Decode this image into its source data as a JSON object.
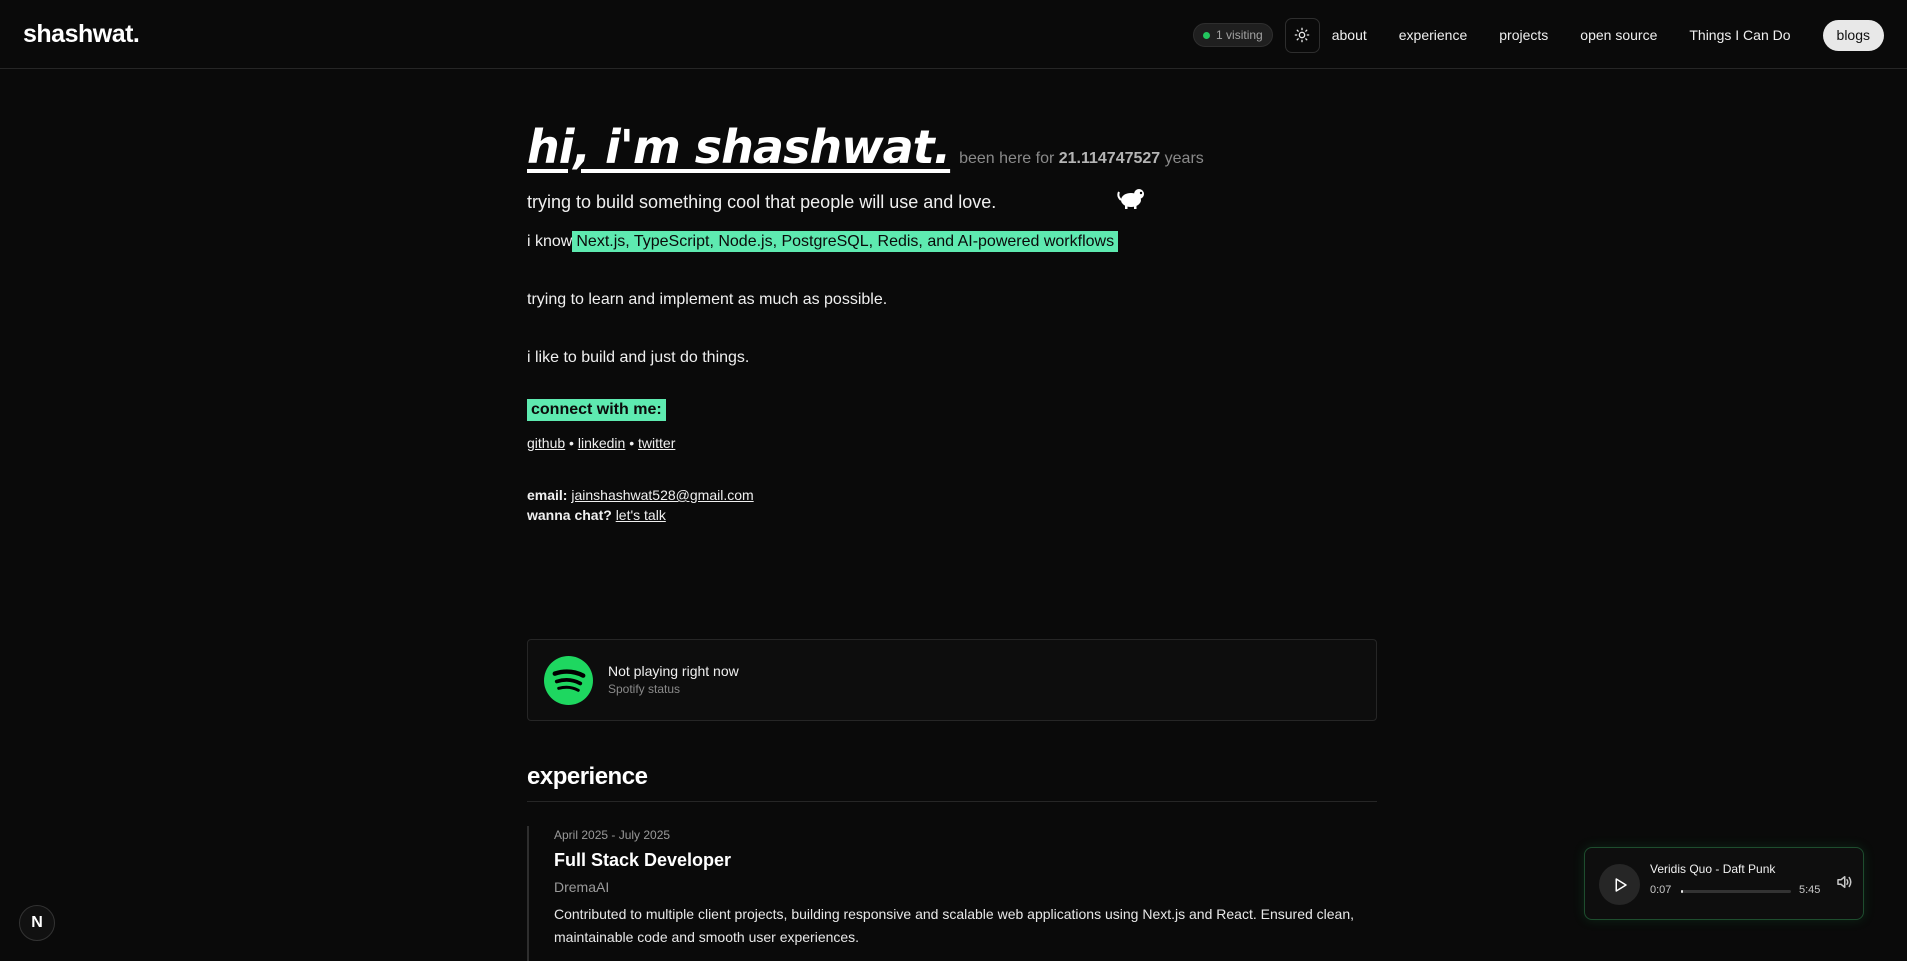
{
  "header": {
    "logo": "shashwat.",
    "visiting": "1 visiting",
    "nav": [
      "about",
      "experience",
      "projects",
      "open source",
      "Things I Can Do"
    ],
    "blogs": "blogs"
  },
  "hero": {
    "title": "hi, i'm shashwat.",
    "been_here_prefix": "been here for",
    "age": "21.114747527",
    "age_unit": "years",
    "tagline": "trying to build something cool that people will use and love.",
    "know_prefix": "i know",
    "skills": "Next.js, TypeScript, Node.js, PostgreSQL, Redis, and AI-powered workflows",
    "learn": "trying to learn and implement as much as possible.",
    "build": "i like to build and just do things.",
    "connect": "connect with me:",
    "socials": [
      "github",
      "linkedin",
      "twitter"
    ],
    "separator": "•",
    "email_label": "email:",
    "email": "jainshashwat528@gmail.com",
    "chat_label": "wanna chat?",
    "chat_link": "let's talk"
  },
  "spotify": {
    "title": "Not playing right now",
    "subtitle": "Spotify status"
  },
  "experience": {
    "heading": "experience",
    "items": [
      {
        "date": "April 2025 - July 2025",
        "role": "Full Stack Developer",
        "company": "DremaAI",
        "description": "Contributed to multiple client projects, building responsive and scalable web applications using Next.js and React. Ensured clean, maintainable code and smooth user experiences."
      }
    ]
  },
  "badge": "N",
  "player": {
    "track": "Veridis Quo - Daft Punk",
    "current": "0:07",
    "duration": "5:45",
    "progress": 0.02
  },
  "colors": {
    "background": "#0a0a0a",
    "highlight": "#5eeab0",
    "spotify_green": "#1ed760",
    "online_dot": "#22c55e"
  }
}
